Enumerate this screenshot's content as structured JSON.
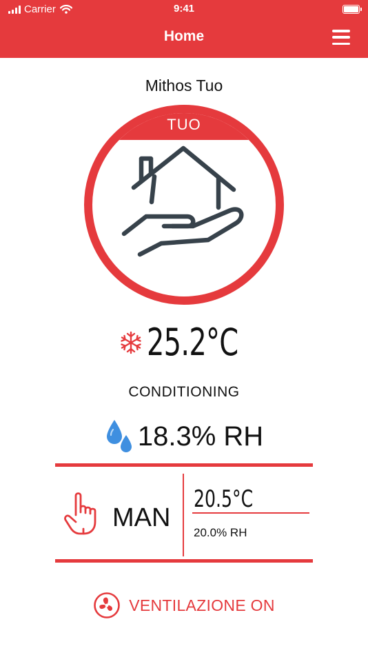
{
  "status_bar": {
    "carrier": "Carrier",
    "time": "9:41"
  },
  "header": {
    "title": "Home",
    "menu_icon": "hamburger-menu-icon"
  },
  "device": {
    "name": "Mithos Tuo",
    "badge_label": "TUO",
    "badge_icon": "house-in-hand-icon"
  },
  "climate": {
    "temperature": "25.2°C",
    "mode_icon": "snowflake-icon",
    "mode": "CONDITIONING",
    "humidity": "18.3% RH",
    "humidity_icon": "water-drops-icon"
  },
  "control": {
    "mode": "MAN",
    "mode_icon": "hand-pointer-icon",
    "setpoint_temperature": "20.5°C",
    "setpoint_humidity": "20.0% RH"
  },
  "ventilation": {
    "label": "VENTILAZIONE ON",
    "icon": "fan-icon"
  },
  "colors": {
    "accent": "#e53a3d",
    "drop": "#3f8fe0",
    "text": "#111111",
    "icon_dark": "#37424b"
  }
}
